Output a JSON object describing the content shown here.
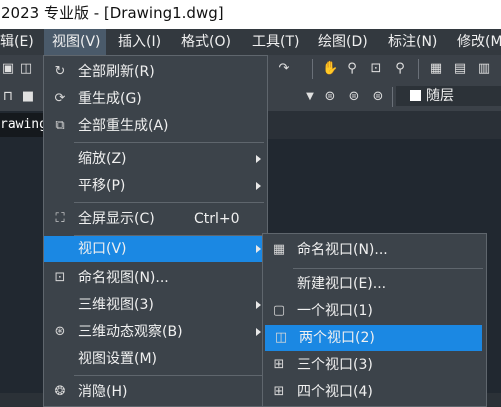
{
  "title": "2023 专业版 - [Drawing1.dwg]",
  "menubar": [
    "辑(E)",
    "视图(V)",
    "插入(I)",
    "格式(O)",
    "工具(T)",
    "绘图(D)",
    "标注(N)",
    "修改(M"
  ],
  "toolbar": {
    "layer_label": "随层"
  },
  "doc_tab": "rawing",
  "view_menu": [
    {
      "label": "全部刷新(R)",
      "icon": "refresh-icon"
    },
    {
      "label": "重生成(G)",
      "icon": "regen-icon"
    },
    {
      "label": "全部重生成(A)",
      "icon": "regen-all-icon"
    },
    {
      "label": "缩放(Z)",
      "submenu": true
    },
    {
      "label": "平移(P)",
      "submenu": true
    },
    {
      "label": "全屏显示(C)",
      "shortcut": "Ctrl+0",
      "icon": "fullscreen-icon"
    },
    {
      "label": "视口(V)",
      "submenu": true,
      "highlighted": true
    },
    {
      "label": "命名视图(N)...",
      "icon": "named-view-icon"
    },
    {
      "label": "三维视图(3)",
      "submenu": true
    },
    {
      "label": "三维动态观察(B)",
      "submenu": true,
      "icon": "orbit-icon"
    },
    {
      "label": "视图设置(M)"
    },
    {
      "label": "消隐(H)",
      "icon": "hide-icon"
    }
  ],
  "viewport_submenu": [
    {
      "label": "命名视口(N)...",
      "icon": "named-viewport-icon"
    },
    {
      "label": "新建视口(E)..."
    },
    {
      "label": "一个视口(1)",
      "icon": "one-viewport-icon"
    },
    {
      "label": "两个视口(2)",
      "icon": "two-viewports-icon",
      "highlighted": true
    },
    {
      "label": "三个视口(3)",
      "icon": "three-viewports-icon"
    },
    {
      "label": "四个视口(4)",
      "icon": "four-viewports-icon"
    }
  ],
  "colors": {
    "highlight": "#1b88e3",
    "menu_bg": "#3c434a",
    "canvas": "#212830"
  }
}
